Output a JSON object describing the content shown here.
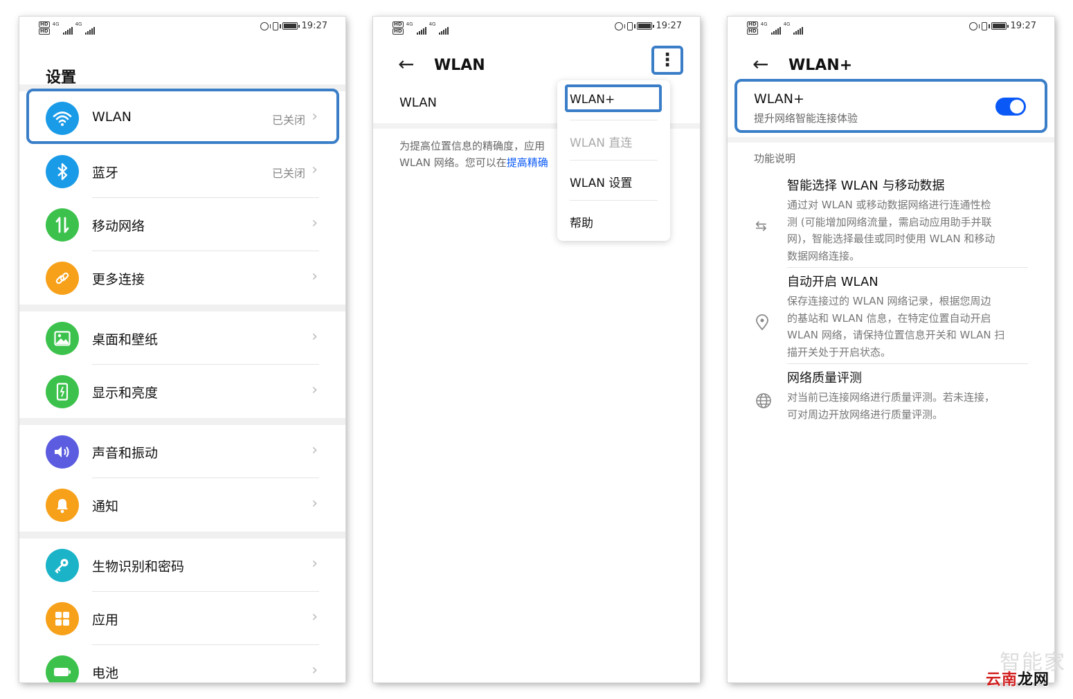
{
  "status_bar": {
    "time": "19:27",
    "signal_label": "4G"
  },
  "settings": {
    "title": "设置",
    "items": [
      {
        "label": "WLAN",
        "value": "已关闭",
        "icon": "wifi-icon",
        "color": "#1a9be8"
      },
      {
        "label": "蓝牙",
        "value": "已关闭",
        "icon": "bluetooth-icon",
        "color": "#1a9be8"
      },
      {
        "label": "移动网络",
        "value": "",
        "icon": "mobile-data-icon",
        "color": "#3cc24c"
      },
      {
        "label": "更多连接",
        "value": "",
        "icon": "link-icon",
        "color": "#f7a11a"
      },
      {
        "label": "桌面和壁纸",
        "value": "",
        "icon": "wallpaper-icon",
        "color": "#3cc24c"
      },
      {
        "label": "显示和亮度",
        "value": "",
        "icon": "display-icon",
        "color": "#3cc24c"
      },
      {
        "label": "声音和振动",
        "value": "",
        "icon": "sound-icon",
        "color": "#5b5ce0"
      },
      {
        "label": "通知",
        "value": "",
        "icon": "bell-icon",
        "color": "#f7a11a"
      },
      {
        "label": "生物识别和密码",
        "value": "",
        "icon": "key-icon",
        "color": "#1ab3c8"
      },
      {
        "label": "应用",
        "value": "",
        "icon": "apps-icon",
        "color": "#f7a11a"
      },
      {
        "label": "电池",
        "value": "",
        "icon": "battery-icon",
        "color": "#3cc24c"
      }
    ]
  },
  "wlan": {
    "title": "WLAN",
    "row_label": "WLAN",
    "desc_prefix": "为提高位置信息的精确度，应用",
    "desc_line2": "WLAN 网络。您可以在",
    "desc_link": "提高精确",
    "menu": [
      {
        "label": "WLAN+",
        "disabled": false
      },
      {
        "label": "WLAN 直连",
        "disabled": true
      },
      {
        "label": "WLAN 设置",
        "disabled": false
      },
      {
        "label": "帮助",
        "disabled": false
      }
    ]
  },
  "wlan_plus": {
    "title": "WLAN+",
    "toggle_name": "WLAN+",
    "toggle_sub": "提升网络智能连接体验",
    "toggle_on": true,
    "section_title": "功能说明",
    "features": [
      {
        "title": "智能选择 WLAN 与移动数据",
        "icon": "swap-icon",
        "desc": [
          "通过对 WLAN 或移动数据网络进行连通性检",
          "测 (可能增加网络流量，需启动应用助手并联",
          "网)，智能选择最佳或同时使用 WLAN 和移动",
          "数据网络连接。"
        ]
      },
      {
        "title": "自动开启 WLAN",
        "icon": "location-pin-icon",
        "desc": [
          "保存连接过的 WLAN 网络记录，根据您周边",
          "的基站和 WLAN 信息，在特定位置自动开启",
          "WLAN 网络，请保持位置信息开关和 WLAN 扫",
          "描开关处于开启状态。"
        ]
      },
      {
        "title": "网络质量评测",
        "icon": "globe-icon",
        "desc": [
          "对当前已连接网络进行质量评测。若未连接，",
          "可对周边开放网络进行质量评测。"
        ]
      }
    ]
  },
  "watermark": {
    "main_red": "云南",
    "main_black": "龙网",
    "faint": "智能家"
  },
  "colors": {
    "accent": "#0a59f7",
    "highlight": "#3a7ec8"
  }
}
